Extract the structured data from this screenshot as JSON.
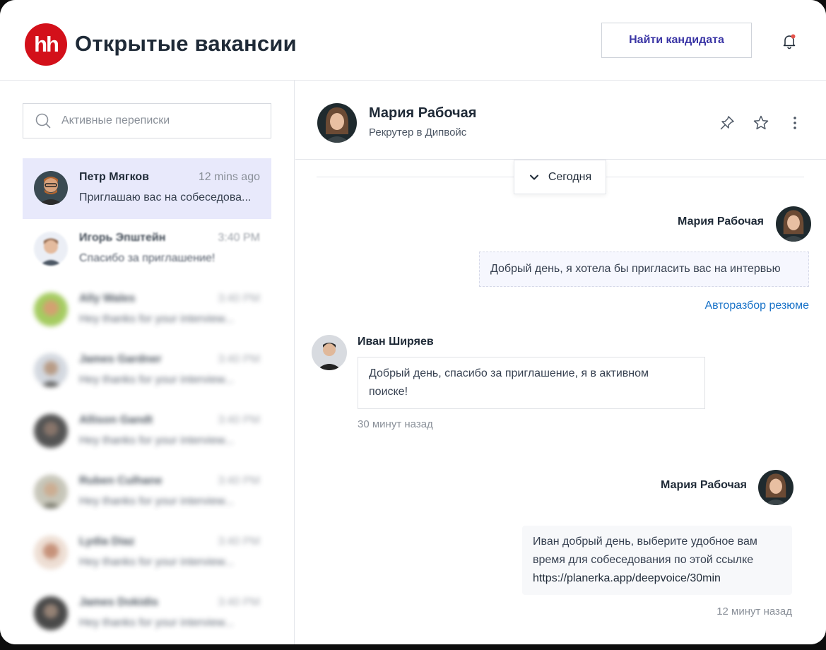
{
  "header": {
    "logo_text": "hh",
    "title": "Открытые вакансии",
    "find_button": "Найти кандидата",
    "brand_color": "#d3101a",
    "accent_color": "#3a35a5"
  },
  "sidebar": {
    "search_placeholder": "Активные переписки",
    "conversations": [
      {
        "name": "Петр Мягков",
        "time": "12 mins ago",
        "preview": "Приглашаю вас на собеседова...",
        "active": true
      },
      {
        "name": "Игорь Эпштейн",
        "time": "3:40 PM",
        "preview": "Спасибо за приглашение!"
      },
      {
        "name": "Ally Wales",
        "time": "3:40 PM",
        "preview": "Hey thanks for your interview..."
      },
      {
        "name": "James Gardner",
        "time": "3:40 PM",
        "preview": "Hey thanks for your interview..."
      },
      {
        "name": "Allison Gandt",
        "time": "3:40 PM",
        "preview": "Hey thanks for your interview..."
      },
      {
        "name": "Ruben Culhane",
        "time": "3:40 PM",
        "preview": "Hey thanks for your interview..."
      },
      {
        "name": "Lydia Diaz",
        "time": "3:40 PM",
        "preview": "Hey thanks for your interview..."
      },
      {
        "name": "James Dokidis",
        "time": "3:40 PM",
        "preview": "Hey thanks for your interview..."
      }
    ]
  },
  "chat": {
    "contact_name": "Мария Рабочая",
    "contact_role": "Рекрутер в Дипвойс",
    "date_label": "Сегодня",
    "messages": [
      {
        "author": "Мария Рабочая",
        "text": "Добрый день, я хотела бы пригласить вас на интервью",
        "link": "Авторазбор резюме"
      },
      {
        "author": "Иван Ширяев",
        "text_line1": "Добрый день, спасибо за приглашение, я в активном",
        "text_line2": "поиске!",
        "meta": "30 минут назад"
      },
      {
        "author": "Мария Рабочая",
        "text_line1": "Иван добрый день, выберите удобное  вам",
        "text_line2": "время для собеседования по этой ссылке",
        "text_line3": "https://planerka.app/deepvoice/30min",
        "meta": "12 минут назад"
      }
    ]
  }
}
